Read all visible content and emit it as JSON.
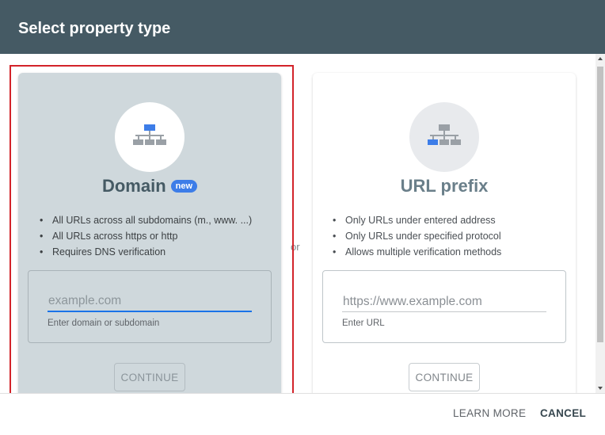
{
  "dialog": {
    "title": "Select property type"
  },
  "domain_card": {
    "title": "Domain",
    "badge": "new",
    "bullets": [
      "All URLs across all subdomains (m., www. ...)",
      "All URLs across https or http",
      "Requires DNS verification"
    ],
    "input": {
      "value": "",
      "placeholder": "example.com",
      "hint": "Enter domain or subdomain"
    },
    "continue_label": "CONTINUE",
    "icon": "sitemap-icon"
  },
  "separator": {
    "label": "or"
  },
  "url_card": {
    "title": "URL prefix",
    "bullets": [
      "Only URLs under entered address",
      "Only URLs under specified protocol",
      "Allows multiple verification methods"
    ],
    "input": {
      "value": "",
      "placeholder": "https://www.example.com",
      "hint": "Enter URL"
    },
    "continue_label": "CONTINUE",
    "icon": "sitemap-icon"
  },
  "footer": {
    "learn_more_label": "LEARN MORE",
    "cancel_label": "CANCEL"
  },
  "colors": {
    "header": "#455a64",
    "accent": "#3d7de8",
    "selected_card": "#cfd8dc",
    "highlight_outline": "#d3232a"
  }
}
